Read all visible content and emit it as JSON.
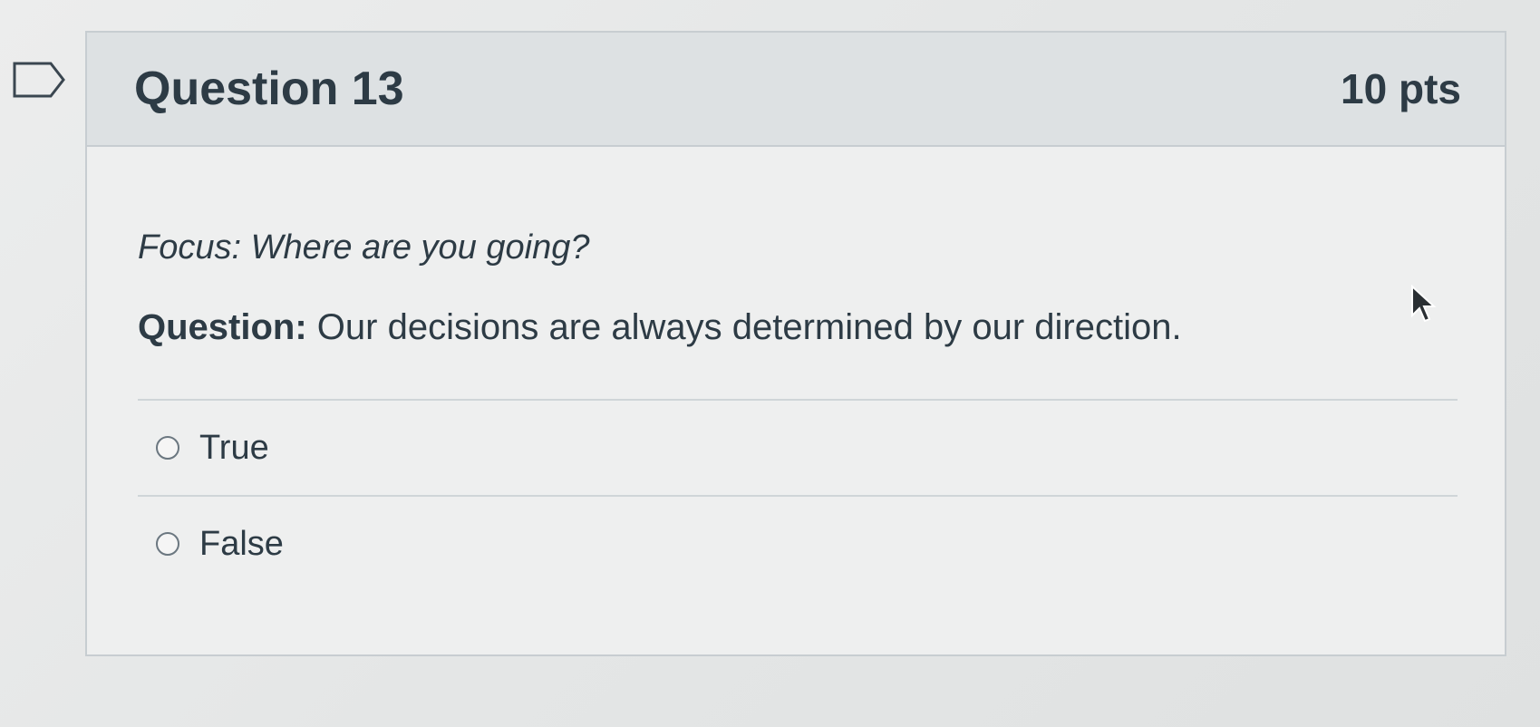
{
  "question": {
    "title": "Question 13",
    "points": "10 pts",
    "focus": "Focus: Where are you going?",
    "question_label": "Question:",
    "question_text": " Our decisions are always determined by our direction.",
    "answers": [
      {
        "label": "True",
        "selected": false
      },
      {
        "label": "False",
        "selected": false
      }
    ]
  },
  "icons": {
    "flag": "flag-question-icon",
    "cursor": "mouse-pointer-icon"
  },
  "colors": {
    "text": "#2d3b45",
    "header_bg": "#dde1e3",
    "border": "#c7cdd1"
  }
}
